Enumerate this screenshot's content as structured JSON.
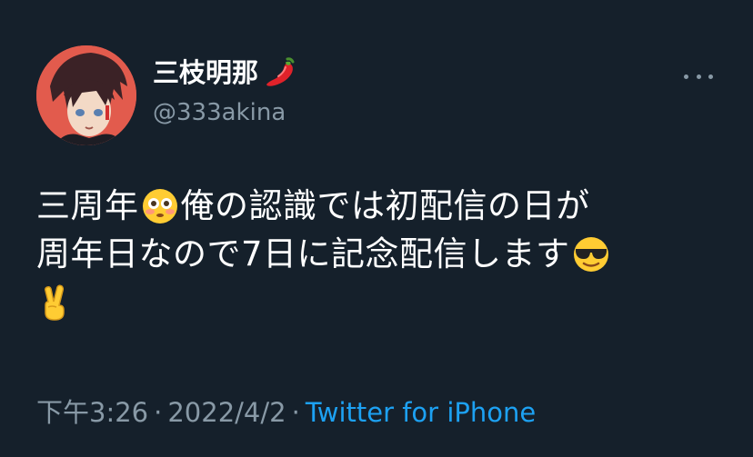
{
  "user": {
    "display_name": "三枝明那",
    "name_emoji": "hot-pepper-icon",
    "handle": "@333akina"
  },
  "tweet": {
    "line1_a": "三周年",
    "line1_emoji": "flushed-face-icon",
    "line1_b": "俺の認識では初配信の日が",
    "line2_a": "周年日なので7日に記念配信します",
    "line2_emoji": "sunglasses-face-icon",
    "line3_emoji": "victory-hand-icon"
  },
  "meta": {
    "time": "下午3:26",
    "separator": "·",
    "date": "2022/4/2",
    "source": "Twitter for iPhone"
  },
  "colors": {
    "background": "#15202b",
    "text": "#ffffff",
    "secondary": "#8899a6",
    "link": "#1da1f2",
    "avatar_bg": "#e25b4d"
  }
}
